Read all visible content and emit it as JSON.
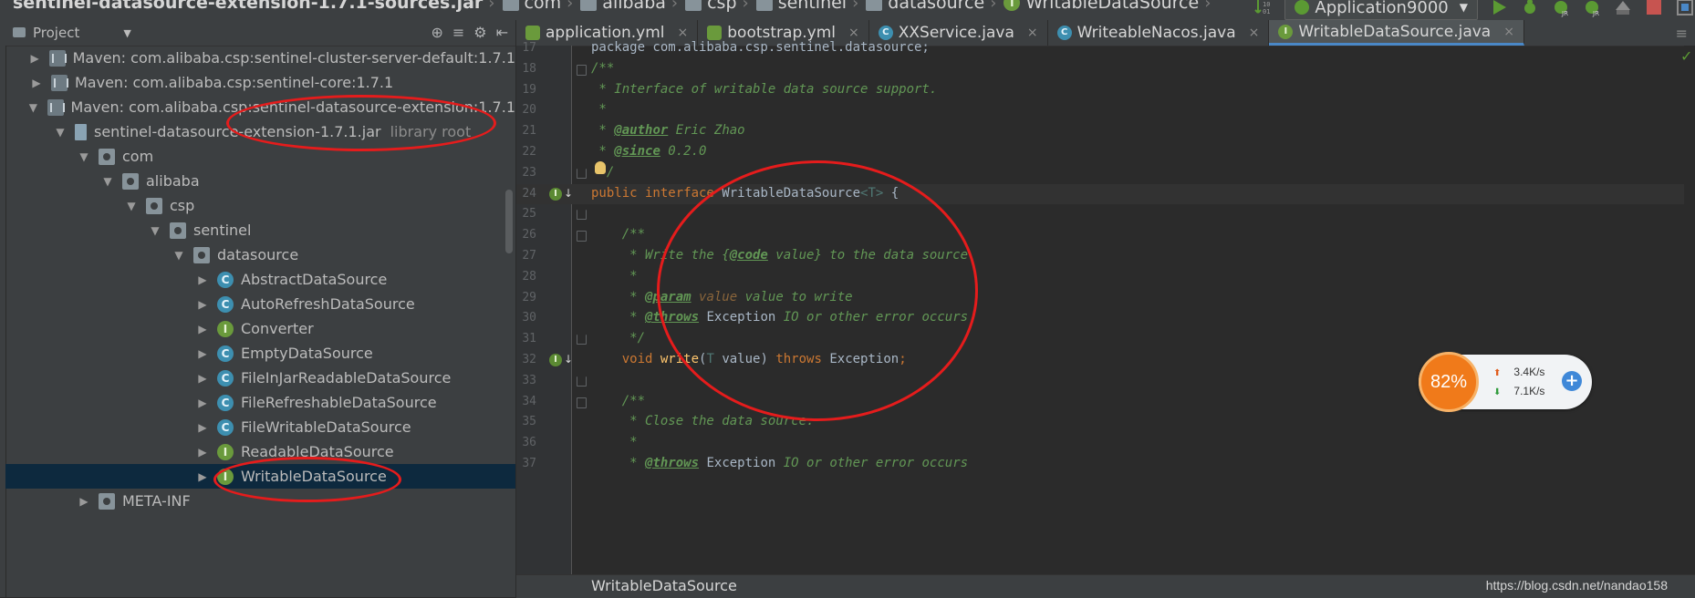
{
  "breadcrumb": {
    "items": [
      {
        "label": "sentinel-datasource-extension-1.7.1-sources.jar",
        "icon": "jar-icon"
      },
      {
        "label": "com",
        "icon": "folder-icon"
      },
      {
        "label": "alibaba",
        "icon": "folder-icon"
      },
      {
        "label": "csp",
        "icon": "folder-icon"
      },
      {
        "label": "sentinel",
        "icon": "folder-icon"
      },
      {
        "label": "datasource",
        "icon": "folder-icon"
      },
      {
        "label": "WritableDataSource",
        "icon": "interface-icon"
      }
    ]
  },
  "toolbar": {
    "run_config": "Application9000",
    "icons": [
      "build-icon",
      "run-icon",
      "debug-icon",
      "jrebel-run-icon",
      "jrebel-debug-icon",
      "coverage-icon",
      "stop-icon",
      "project-structure-icon"
    ]
  },
  "project_panel": {
    "title": "Project",
    "tools": [
      "locate-icon",
      "collapse-icon",
      "settings-icon",
      "hide-icon"
    ],
    "tree": [
      {
        "depth": 0,
        "expanded": false,
        "icon": "library",
        "label": "Maven: com.alibaba.csp:sentinel-cluster-server-default:1.7.1",
        "note": ""
      },
      {
        "depth": 0,
        "expanded": false,
        "icon": "library",
        "label": "Maven: com.alibaba.csp:sentinel-core:1.7.1",
        "note": ""
      },
      {
        "depth": 0,
        "expanded": true,
        "icon": "library",
        "label": "Maven: com.alibaba.csp:sentinel-datasource-extension:1.7.1",
        "note": ""
      },
      {
        "depth": 1,
        "expanded": true,
        "icon": "jar",
        "label": "sentinel-datasource-extension-1.7.1.jar",
        "note": "library root"
      },
      {
        "depth": 2,
        "expanded": true,
        "icon": "package",
        "label": "com",
        "note": ""
      },
      {
        "depth": 3,
        "expanded": true,
        "icon": "package",
        "label": "alibaba",
        "note": ""
      },
      {
        "depth": 4,
        "expanded": true,
        "icon": "package",
        "label": "csp",
        "note": ""
      },
      {
        "depth": 5,
        "expanded": true,
        "icon": "package",
        "label": "sentinel",
        "note": ""
      },
      {
        "depth": 6,
        "expanded": true,
        "icon": "package",
        "label": "datasource",
        "note": ""
      },
      {
        "depth": 7,
        "expanded": false,
        "icon": "class",
        "label": "AbstractDataSource",
        "note": ""
      },
      {
        "depth": 7,
        "expanded": false,
        "icon": "class",
        "label": "AutoRefreshDataSource",
        "note": ""
      },
      {
        "depth": 7,
        "expanded": false,
        "icon": "interface",
        "label": "Converter",
        "note": ""
      },
      {
        "depth": 7,
        "expanded": false,
        "icon": "class",
        "label": "EmptyDataSource",
        "note": ""
      },
      {
        "depth": 7,
        "expanded": false,
        "icon": "class",
        "label": "FileInJarReadableDataSource",
        "note": ""
      },
      {
        "depth": 7,
        "expanded": false,
        "icon": "class",
        "label": "FileRefreshableDataSource",
        "note": ""
      },
      {
        "depth": 7,
        "expanded": false,
        "icon": "class",
        "label": "FileWritableDataSource",
        "note": ""
      },
      {
        "depth": 7,
        "expanded": false,
        "icon": "interface",
        "label": "ReadableDataSource",
        "note": ""
      },
      {
        "depth": 7,
        "expanded": false,
        "icon": "interface",
        "label": "WritableDataSource",
        "note": "",
        "selected": true
      },
      {
        "depth": 2,
        "expanded": false,
        "icon": "package",
        "label": "META-INF",
        "note": ""
      }
    ]
  },
  "editor": {
    "tabs": [
      {
        "label": "application.yml",
        "icon": "yml",
        "active": false
      },
      {
        "label": "bootstrap.yml",
        "icon": "yml",
        "active": false
      },
      {
        "label": "XXService.java",
        "icon": "cls",
        "active": false
      },
      {
        "label": "WriteableNacos.java",
        "icon": "cls",
        "active": false
      },
      {
        "label": "WritableDataSource.java",
        "icon": "ifc",
        "active": true
      }
    ],
    "lines": [
      {
        "n": "17",
        "tokens": [
          [
            "c-id",
            "package com.alibaba.csp.sentinel.datasource;"
          ]
        ]
      },
      {
        "n": "18",
        "tokens": [
          [
            "c-com",
            "/**"
          ]
        ]
      },
      {
        "n": "19",
        "tokens": [
          [
            "c-com",
            " * Interface of writable data source support."
          ]
        ]
      },
      {
        "n": "20",
        "tokens": [
          [
            "c-com",
            " *"
          ]
        ]
      },
      {
        "n": "21",
        "tokens": [
          [
            "c-com",
            " * "
          ],
          [
            "c-tag",
            "@author"
          ],
          [
            "c-com",
            " Eric Zhao"
          ]
        ]
      },
      {
        "n": "22",
        "tokens": [
          [
            "c-com",
            " * "
          ],
          [
            "c-tag",
            "@since"
          ],
          [
            "c-com",
            " 0.2.0"
          ]
        ]
      },
      {
        "n": "23",
        "tokens": [
          [
            "c-com",
            " */"
          ]
        ]
      },
      {
        "n": "24",
        "tokens": [
          [
            "c-kw",
            "public interface "
          ],
          [
            "c-id",
            "WritableDataSource"
          ],
          [
            "c-type",
            "<T>"
          ],
          [
            "c-id",
            " {"
          ]
        ]
      },
      {
        "n": "25",
        "tokens": []
      },
      {
        "n": "26",
        "tokens": [
          [
            "c-com",
            "    /**"
          ]
        ]
      },
      {
        "n": "27",
        "tokens": [
          [
            "c-com",
            "     * Write the {"
          ],
          [
            "c-tag",
            "@code"
          ],
          [
            "c-com",
            " value} to the data source."
          ]
        ]
      },
      {
        "n": "28",
        "tokens": [
          [
            "c-com",
            "     *"
          ]
        ]
      },
      {
        "n": "29",
        "tokens": [
          [
            "c-com",
            "     * "
          ],
          [
            "c-tag",
            "@param"
          ],
          [
            "c-param",
            " value"
          ],
          [
            "c-com",
            " value to write"
          ]
        ]
      },
      {
        "n": "30",
        "tokens": [
          [
            "c-com",
            "     * "
          ],
          [
            "c-tag",
            "@throws"
          ],
          [
            "c-id",
            " Exception"
          ],
          [
            "c-com",
            " IO or other error occurs"
          ]
        ]
      },
      {
        "n": "31",
        "tokens": [
          [
            "c-com",
            "     */"
          ]
        ]
      },
      {
        "n": "32",
        "tokens": [
          [
            "c-kw",
            "    void "
          ],
          [
            "c-fn",
            "write"
          ],
          [
            "c-id",
            "("
          ],
          [
            "c-type",
            "T"
          ],
          [
            "c-id",
            " value) "
          ],
          [
            "c-kw",
            "throws "
          ],
          [
            "c-id",
            "Exception"
          ],
          [
            "c-kw",
            ";"
          ]
        ]
      },
      {
        "n": "33",
        "tokens": []
      },
      {
        "n": "34",
        "tokens": [
          [
            "c-com",
            "    /**"
          ]
        ]
      },
      {
        "n": "35",
        "tokens": [
          [
            "c-com",
            "     * Close the data source."
          ]
        ]
      },
      {
        "n": "36",
        "tokens": [
          [
            "c-com",
            "     *"
          ]
        ]
      },
      {
        "n": "37",
        "tokens": [
          [
            "c-com",
            "     * "
          ],
          [
            "c-tag",
            "@throws"
          ],
          [
            "c-id",
            " Exception"
          ],
          [
            "c-com",
            " IO or other error occurs"
          ]
        ]
      }
    ]
  },
  "status": {
    "structure_text": "WritableDataSource",
    "watermark": "https://blog.csdn.net/nandao158"
  },
  "net_widget": {
    "percent": "82%",
    "upload": "3.4K/s",
    "download": "7.1K/s"
  },
  "colors": {
    "annotation": "#e51c1c",
    "selection": "#0d293e",
    "accent": "#4a88c7"
  }
}
